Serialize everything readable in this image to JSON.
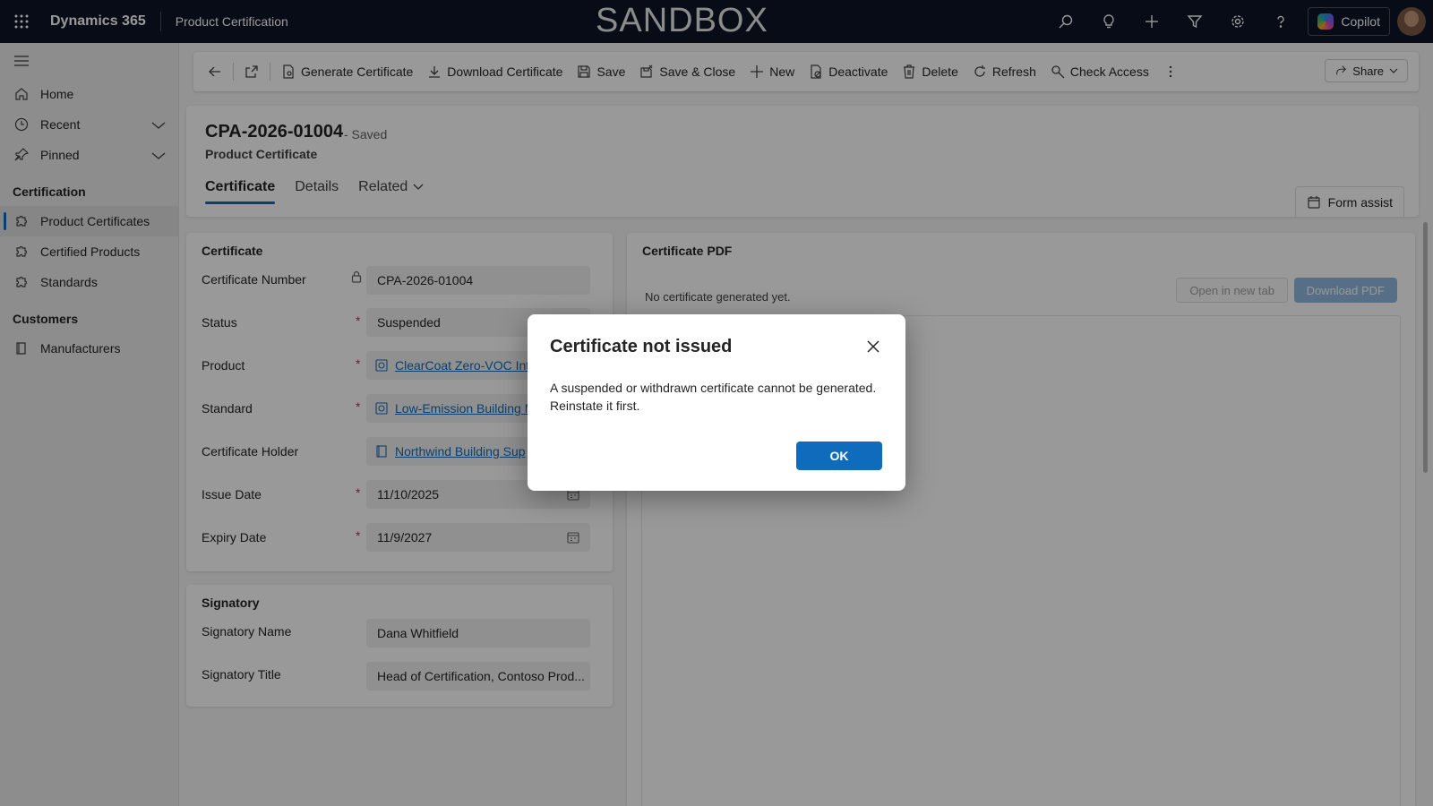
{
  "topbar": {
    "app_name": "Dynamics 365",
    "area_name": "Product Certification",
    "environment_label": "SANDBOX",
    "copilot_label": "Copilot",
    "icons": [
      "search-icon",
      "lightbulb-icon",
      "plus-icon",
      "filter-icon",
      "settings-icon",
      "help-icon"
    ]
  },
  "sidebar": {
    "items": [
      {
        "label": "Home",
        "icon": "home-icon"
      },
      {
        "label": "Recent",
        "icon": "clock-icon"
      },
      {
        "label": "Pinned",
        "icon": "pin-icon"
      }
    ],
    "sections": [
      {
        "title": "Certification",
        "items": [
          {
            "label": "Product Certificates",
            "icon": "puzzle-icon",
            "active": true
          },
          {
            "label": "Certified Products",
            "icon": "puzzle-icon"
          },
          {
            "label": "Standards",
            "icon": "puzzle-icon"
          }
        ]
      },
      {
        "title": "Customers",
        "items": [
          {
            "label": "Manufacturers",
            "icon": "book-icon"
          }
        ]
      }
    ]
  },
  "commandbar": {
    "generate_certificate": "Generate Certificate",
    "download_certificate": "Download Certificate",
    "save": "Save",
    "save_close": "Save & Close",
    "new": "New",
    "deactivate": "Deactivate",
    "delete": "Delete",
    "refresh": "Refresh",
    "check_access": "Check Access",
    "share": "Share"
  },
  "record": {
    "title": "CPA-2026-01004",
    "state": "- Saved",
    "entity": "Product Certificate",
    "tabs": [
      "Certificate",
      "Details",
      "Related"
    ],
    "form_assist": "Form assist"
  },
  "certificate_section": {
    "title": "Certificate",
    "fields": {
      "number_label": "Certificate Number",
      "number_value": "CPA-2026-01004",
      "status_label": "Status",
      "status_value": "Suspended",
      "product_label": "Product",
      "product_value": "ClearCoat Zero-VOC Inte",
      "standard_label": "Standard",
      "standard_value": "Low-Emission Building M",
      "holder_label": "Certificate Holder",
      "holder_value": "Northwind Building Sup",
      "issue_label": "Issue Date",
      "issue_value": "11/10/2025",
      "expiry_label": "Expiry Date",
      "expiry_value": "11/9/2027"
    }
  },
  "signatory_section": {
    "title": "Signatory",
    "name_label": "Signatory Name",
    "name_value": "Dana Whitfield",
    "title_label": "Signatory Title",
    "title_value": "Head of Certification, Contoso Prod..."
  },
  "pdf_section": {
    "title": "Certificate PDF",
    "empty_text": "No certificate generated yet.",
    "open_tab": "Open in new tab",
    "download": "Download PDF"
  },
  "dialog": {
    "title": "Certificate not issued",
    "body": "A suspended or withdrawn certificate cannot be generated. Reinstate it first.",
    "ok": "OK"
  },
  "colors": {
    "topbar": "#0c1427",
    "accent": "#0f6cbd",
    "required": "#c4314b"
  }
}
